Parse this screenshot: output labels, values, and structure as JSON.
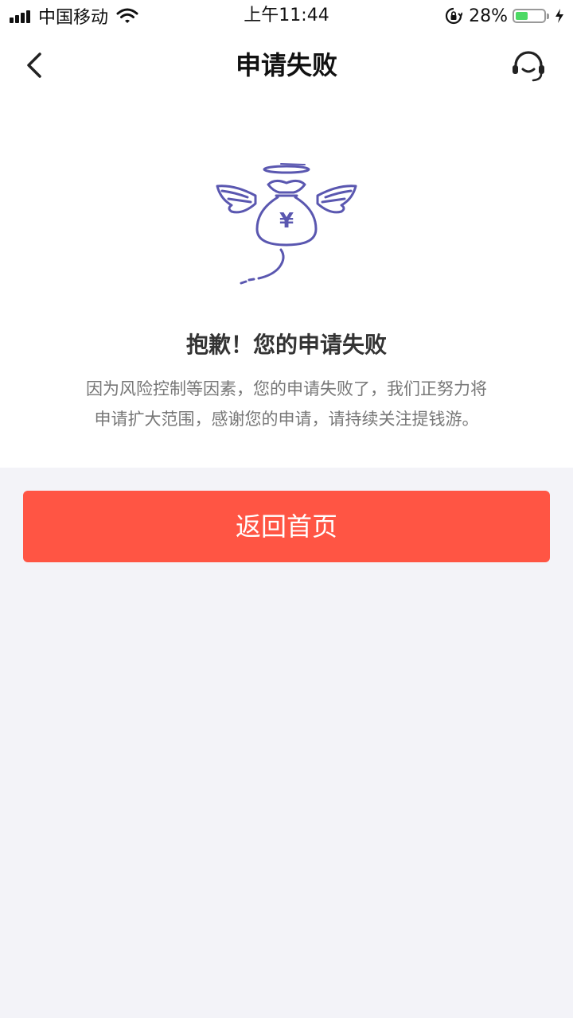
{
  "status_bar": {
    "carrier": "中国移动",
    "time": "上午11:44",
    "battery_percent": "28%",
    "battery_level": 0.28
  },
  "nav": {
    "title": "申请失败",
    "back_icon": "chevron-left-icon",
    "service_icon": "customer-service-headset-icon"
  },
  "content": {
    "illustration": "winged-money-bag-icon",
    "illustration_symbol": "¥",
    "headline": "抱歉！您的申请失败",
    "description_line1": "因为风险控制等因素，您的申请失败了，我们正努力将",
    "description_line2": "申请扩大范围，感谢您的申请，请持续关注提钱游。"
  },
  "actions": {
    "home_button_label": "返回首页"
  },
  "colors": {
    "accent": "#ff5544",
    "illustration": "#5a57b0",
    "background": "#f3f3f8",
    "battery": "#4cd964"
  }
}
